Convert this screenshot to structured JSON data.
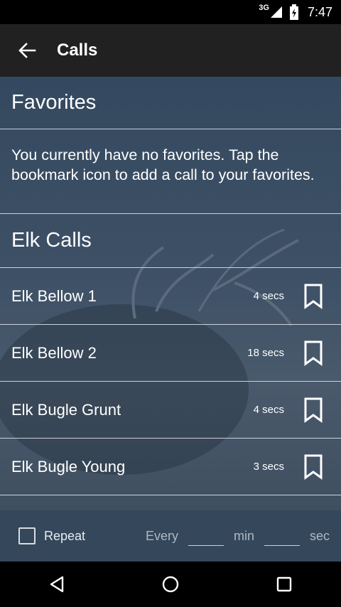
{
  "status_bar": {
    "network": "3G",
    "time": "7:47"
  },
  "app_bar": {
    "title": "Calls",
    "back_icon": "arrow-back-icon"
  },
  "favorites": {
    "header": "Favorites",
    "empty_message": "You currently have no favorites. Tap the bookmark icon to add a call to your favorites."
  },
  "elk_calls": {
    "header": "Elk Calls",
    "items": [
      {
        "name": "Elk Bellow 1",
        "duration": "4 secs",
        "icon": "bookmark-outline-icon"
      },
      {
        "name": "Elk Bellow 2",
        "duration": "18 secs",
        "icon": "bookmark-outline-icon"
      },
      {
        "name": "Elk Bugle Grunt",
        "duration": "4 secs",
        "icon": "bookmark-outline-icon"
      },
      {
        "name": "Elk Bugle Young",
        "duration": "3 secs",
        "icon": "bookmark-outline-icon"
      }
    ]
  },
  "controls": {
    "repeat_label": "Repeat",
    "repeat_checked": false,
    "every_label": "Every",
    "min_value": "",
    "min_label": "min",
    "sec_value": "",
    "sec_label": "sec"
  },
  "colors": {
    "app_bar": "#212121",
    "content_bg": "#34495f",
    "divider": "#c9d2db",
    "controls_bg": "#34475b"
  }
}
